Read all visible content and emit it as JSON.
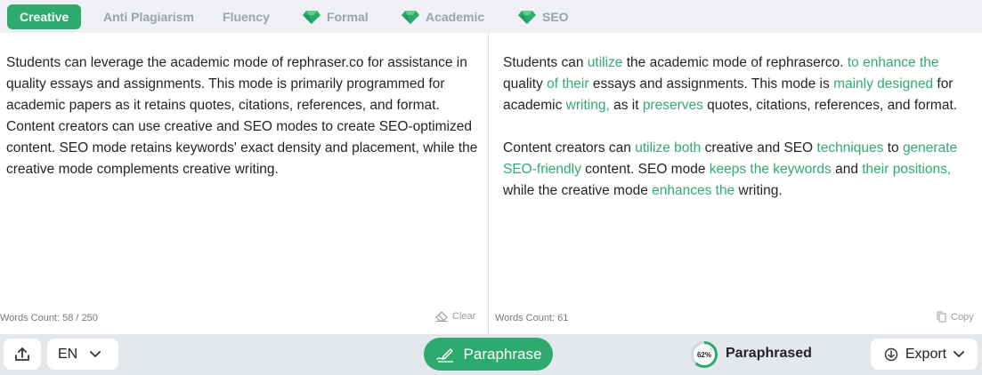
{
  "modes": [
    {
      "label": "Creative",
      "active": true,
      "premium": false
    },
    {
      "label": "Anti Plagiarism",
      "active": false,
      "premium": false
    },
    {
      "label": "Fluency",
      "active": false,
      "premium": false
    },
    {
      "label": "Formal",
      "active": false,
      "premium": true
    },
    {
      "label": "Academic",
      "active": false,
      "premium": true
    },
    {
      "label": "SEO",
      "active": false,
      "premium": true
    }
  ],
  "input": {
    "paragraphs": [
      "Students can leverage the academic mode of rephraser.co for assistance in quality essays and assignments. This mode is primarily programmed for academic papers as it retains quotes, citations, references, and format.",
      "Content creators can use creative and SEO modes to create SEO-optimized content. SEO mode retains keywords' exact density and placement, while the creative mode complements creative writing."
    ],
    "word_count": "Words Count: 58 / 250",
    "clear_label": "Clear"
  },
  "output": {
    "paragraphs": [
      [
        {
          "t": "Students can ",
          "hl": false
        },
        {
          "t": "utilize",
          "hl": true
        },
        {
          "t": " the academic mode of rephraserco. ",
          "hl": false
        },
        {
          "t": "to enhance the",
          "hl": true
        },
        {
          "t": " quality ",
          "hl": false
        },
        {
          "t": "of their",
          "hl": true
        },
        {
          "t": " essays and assignments. This mode is ",
          "hl": false
        },
        {
          "t": "mainly designed",
          "hl": true
        },
        {
          "t": " for academic ",
          "hl": false
        },
        {
          "t": "writing,",
          "hl": true
        },
        {
          "t": " as it ",
          "hl": false
        },
        {
          "t": "preserves",
          "hl": true
        },
        {
          "t": " quotes, citations, references, and format.",
          "hl": false
        }
      ],
      [
        {
          "t": "Content creators can ",
          "hl": false
        },
        {
          "t": "utilize both",
          "hl": true
        },
        {
          "t": " creative and SEO ",
          "hl": false
        },
        {
          "t": "techniques",
          "hl": true
        },
        {
          "t": " to ",
          "hl": false
        },
        {
          "t": "generate SEO-friendly",
          "hl": true
        },
        {
          "t": " content. SEO mode ",
          "hl": false
        },
        {
          "t": "keeps the keywords",
          "hl": true
        },
        {
          "t": " and ",
          "hl": false
        },
        {
          "t": "their positions,",
          "hl": true
        },
        {
          "t": " while the creative mode ",
          "hl": false
        },
        {
          "t": "enhances the",
          "hl": true
        },
        {
          "t": " writing.",
          "hl": false
        }
      ]
    ],
    "word_count": "Words Count: 61",
    "copy_label": "Copy"
  },
  "bottom": {
    "language": "EN",
    "paraphrase_label": "Paraphrase",
    "progress_percent": 62,
    "progress_text": "62%",
    "status_label": "Paraphrased",
    "export_label": "Export"
  },
  "colors": {
    "accent": "#2eaa6e",
    "highlight_text": "#34a874",
    "premium_gem": "#2eaa6e"
  },
  "icons": {
    "upload": "upload-icon",
    "chevron": "chevron-down-icon",
    "gem": "gem-icon",
    "clear": "eraser-icon",
    "copy": "copy-icon",
    "paraphrase": "paraphrase-pen-icon",
    "export": "download-icon"
  }
}
